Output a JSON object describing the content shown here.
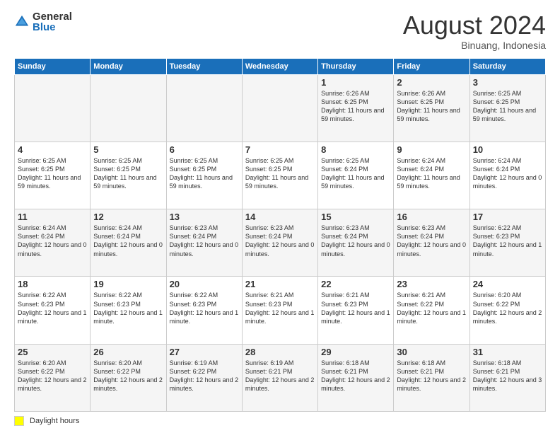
{
  "logo": {
    "general": "General",
    "blue": "Blue"
  },
  "header": {
    "month": "August 2024",
    "location": "Binuang, Indonesia"
  },
  "weekdays": [
    "Sunday",
    "Monday",
    "Tuesday",
    "Wednesday",
    "Thursday",
    "Friday",
    "Saturday"
  ],
  "footer": {
    "legend_label": "Daylight hours"
  },
  "weeks": [
    [
      {
        "day": "",
        "info": ""
      },
      {
        "day": "",
        "info": ""
      },
      {
        "day": "",
        "info": ""
      },
      {
        "day": "",
        "info": ""
      },
      {
        "day": "1",
        "info": "Sunrise: 6:26 AM\nSunset: 6:25 PM\nDaylight: 11 hours and 59 minutes."
      },
      {
        "day": "2",
        "info": "Sunrise: 6:26 AM\nSunset: 6:25 PM\nDaylight: 11 hours and 59 minutes."
      },
      {
        "day": "3",
        "info": "Sunrise: 6:25 AM\nSunset: 6:25 PM\nDaylight: 11 hours and 59 minutes."
      }
    ],
    [
      {
        "day": "4",
        "info": "Sunrise: 6:25 AM\nSunset: 6:25 PM\nDaylight: 11 hours and 59 minutes."
      },
      {
        "day": "5",
        "info": "Sunrise: 6:25 AM\nSunset: 6:25 PM\nDaylight: 11 hours and 59 minutes."
      },
      {
        "day": "6",
        "info": "Sunrise: 6:25 AM\nSunset: 6:25 PM\nDaylight: 11 hours and 59 minutes."
      },
      {
        "day": "7",
        "info": "Sunrise: 6:25 AM\nSunset: 6:25 PM\nDaylight: 11 hours and 59 minutes."
      },
      {
        "day": "8",
        "info": "Sunrise: 6:25 AM\nSunset: 6:24 PM\nDaylight: 11 hours and 59 minutes."
      },
      {
        "day": "9",
        "info": "Sunrise: 6:24 AM\nSunset: 6:24 PM\nDaylight: 11 hours and 59 minutes."
      },
      {
        "day": "10",
        "info": "Sunrise: 6:24 AM\nSunset: 6:24 PM\nDaylight: 12 hours and 0 minutes."
      }
    ],
    [
      {
        "day": "11",
        "info": "Sunrise: 6:24 AM\nSunset: 6:24 PM\nDaylight: 12 hours and 0 minutes."
      },
      {
        "day": "12",
        "info": "Sunrise: 6:24 AM\nSunset: 6:24 PM\nDaylight: 12 hours and 0 minutes."
      },
      {
        "day": "13",
        "info": "Sunrise: 6:23 AM\nSunset: 6:24 PM\nDaylight: 12 hours and 0 minutes."
      },
      {
        "day": "14",
        "info": "Sunrise: 6:23 AM\nSunset: 6:24 PM\nDaylight: 12 hours and 0 minutes."
      },
      {
        "day": "15",
        "info": "Sunrise: 6:23 AM\nSunset: 6:24 PM\nDaylight: 12 hours and 0 minutes."
      },
      {
        "day": "16",
        "info": "Sunrise: 6:23 AM\nSunset: 6:24 PM\nDaylight: 12 hours and 0 minutes."
      },
      {
        "day": "17",
        "info": "Sunrise: 6:22 AM\nSunset: 6:23 PM\nDaylight: 12 hours and 1 minute."
      }
    ],
    [
      {
        "day": "18",
        "info": "Sunrise: 6:22 AM\nSunset: 6:23 PM\nDaylight: 12 hours and 1 minute."
      },
      {
        "day": "19",
        "info": "Sunrise: 6:22 AM\nSunset: 6:23 PM\nDaylight: 12 hours and 1 minute."
      },
      {
        "day": "20",
        "info": "Sunrise: 6:22 AM\nSunset: 6:23 PM\nDaylight: 12 hours and 1 minute."
      },
      {
        "day": "21",
        "info": "Sunrise: 6:21 AM\nSunset: 6:23 PM\nDaylight: 12 hours and 1 minute."
      },
      {
        "day": "22",
        "info": "Sunrise: 6:21 AM\nSunset: 6:23 PM\nDaylight: 12 hours and 1 minute."
      },
      {
        "day": "23",
        "info": "Sunrise: 6:21 AM\nSunset: 6:22 PM\nDaylight: 12 hours and 1 minute."
      },
      {
        "day": "24",
        "info": "Sunrise: 6:20 AM\nSunset: 6:22 PM\nDaylight: 12 hours and 2 minutes."
      }
    ],
    [
      {
        "day": "25",
        "info": "Sunrise: 6:20 AM\nSunset: 6:22 PM\nDaylight: 12 hours and 2 minutes."
      },
      {
        "day": "26",
        "info": "Sunrise: 6:20 AM\nSunset: 6:22 PM\nDaylight: 12 hours and 2 minutes."
      },
      {
        "day": "27",
        "info": "Sunrise: 6:19 AM\nSunset: 6:22 PM\nDaylight: 12 hours and 2 minutes."
      },
      {
        "day": "28",
        "info": "Sunrise: 6:19 AM\nSunset: 6:21 PM\nDaylight: 12 hours and 2 minutes."
      },
      {
        "day": "29",
        "info": "Sunrise: 6:18 AM\nSunset: 6:21 PM\nDaylight: 12 hours and 2 minutes."
      },
      {
        "day": "30",
        "info": "Sunrise: 6:18 AM\nSunset: 6:21 PM\nDaylight: 12 hours and 2 minutes."
      },
      {
        "day": "31",
        "info": "Sunrise: 6:18 AM\nSunset: 6:21 PM\nDaylight: 12 hours and 3 minutes."
      }
    ]
  ]
}
